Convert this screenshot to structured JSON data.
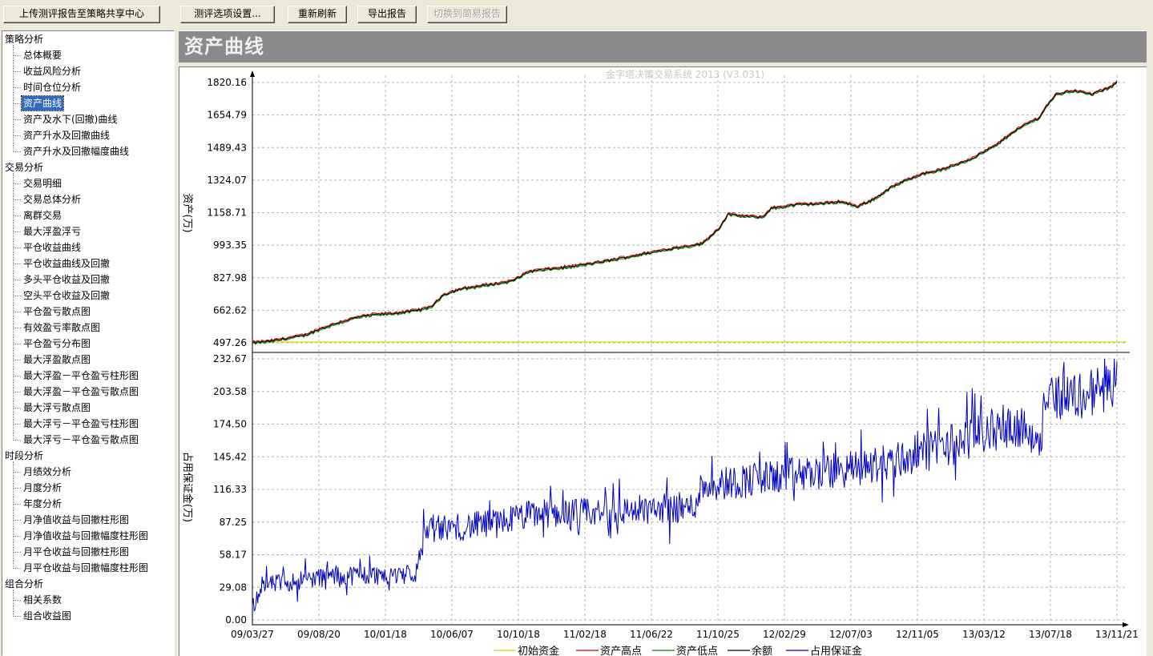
{
  "toolbar": {
    "upload_label": "上传测评报告至策略共享中心",
    "options_label": "测评选项设置...",
    "refresh_label": "重新刷新",
    "export_label": "导出报告",
    "simple_label": "切换到简易报告"
  },
  "tree": {
    "categories": [
      {
        "label": "策略分析",
        "items": [
          "总体概要",
          "收益风险分析",
          "时间仓位分析",
          "资产曲线",
          "资产及水下(回撤)曲线",
          "资产升水及回撤曲线",
          "资产升水及回撤幅度曲线"
        ]
      },
      {
        "label": "交易分析",
        "items": [
          "交易明细",
          "交易总体分析",
          "离群交易",
          "最大浮盈浮亏",
          "平仓收益曲线",
          "平仓收益曲线及回撤",
          "多头平仓收益及回撤",
          "空头平仓收益及回撤",
          "平仓盈亏散点图",
          "有效盈亏率散点图",
          "平仓盈亏分布图",
          "最大浮盈散点图",
          "最大浮盈－平仓盈亏柱形图",
          "最大浮盈－平仓盈亏散点图",
          "最大浮亏散点图",
          "最大浮亏－平仓盈亏柱形图",
          "最大浮亏－平仓盈亏散点图"
        ]
      },
      {
        "label": "时段分析",
        "items": [
          "月绩效分析",
          "月度分析",
          "年度分析",
          "月净值收益与回撤柱形图",
          "月净值收益与回撤幅度柱形图",
          "月平仓收益与回撤柱形图",
          "月平仓收益与回撤幅度柱形图"
        ]
      },
      {
        "label": "组合分析",
        "items": [
          "相关系数",
          "组合收益图"
        ]
      }
    ],
    "selected": "资产曲线"
  },
  "header": {
    "title": "资产曲线"
  },
  "chart_data": {
    "type": "line",
    "title": "金字塔决策交易系统 2013 (V3.031)",
    "x_tick_labels": [
      "09/03/27",
      "09/08/20",
      "10/01/18",
      "10/06/07",
      "10/10/18",
      "11/02/18",
      "11/06/22",
      "11/10/25",
      "12/02/29",
      "12/07/03",
      "12/11/05",
      "13/03/12",
      "13/07/18",
      "13/11/21"
    ],
    "x_range": [
      "09/03/27",
      "13/11/21"
    ],
    "upper_panel": {
      "ylabel": "资产(万)",
      "y_tick_labels": [
        "1820.16",
        "1654.79",
        "1489.43",
        "1324.07",
        "1158.71",
        "993.35",
        "827.98",
        "662.62",
        "497.26"
      ],
      "ylim": [
        497.26,
        1820.16
      ],
      "initial_capital": 497.26,
      "balance_points": [
        {
          "x": 0,
          "y": 497
        },
        {
          "x": 0.02,
          "y": 505
        },
        {
          "x": 0.04,
          "y": 520
        },
        {
          "x": 0.06,
          "y": 535
        },
        {
          "x": 0.08,
          "y": 570
        },
        {
          "x": 0.1,
          "y": 600
        },
        {
          "x": 0.12,
          "y": 625
        },
        {
          "x": 0.14,
          "y": 640
        },
        {
          "x": 0.16,
          "y": 645
        },
        {
          "x": 0.18,
          "y": 655
        },
        {
          "x": 0.2,
          "y": 670
        },
        {
          "x": 0.21,
          "y": 690
        },
        {
          "x": 0.22,
          "y": 740
        },
        {
          "x": 0.24,
          "y": 770
        },
        {
          "x": 0.27,
          "y": 790
        },
        {
          "x": 0.3,
          "y": 810
        },
        {
          "x": 0.32,
          "y": 860
        },
        {
          "x": 0.34,
          "y": 870
        },
        {
          "x": 0.37,
          "y": 885
        },
        {
          "x": 0.4,
          "y": 905
        },
        {
          "x": 0.43,
          "y": 930
        },
        {
          "x": 0.46,
          "y": 955
        },
        {
          "x": 0.49,
          "y": 980
        },
        {
          "x": 0.52,
          "y": 1000
        },
        {
          "x": 0.54,
          "y": 1080
        },
        {
          "x": 0.55,
          "y": 1150
        },
        {
          "x": 0.57,
          "y": 1140
        },
        {
          "x": 0.59,
          "y": 1135
        },
        {
          "x": 0.6,
          "y": 1180
        },
        {
          "x": 0.63,
          "y": 1200
        },
        {
          "x": 0.66,
          "y": 1205
        },
        {
          "x": 0.68,
          "y": 1215
        },
        {
          "x": 0.7,
          "y": 1190
        },
        {
          "x": 0.72,
          "y": 1230
        },
        {
          "x": 0.74,
          "y": 1290
        },
        {
          "x": 0.77,
          "y": 1350
        },
        {
          "x": 0.8,
          "y": 1380
        },
        {
          "x": 0.83,
          "y": 1430
        },
        {
          "x": 0.86,
          "y": 1500
        },
        {
          "x": 0.88,
          "y": 1570
        },
        {
          "x": 0.9,
          "y": 1620
        },
        {
          "x": 0.91,
          "y": 1640
        },
        {
          "x": 0.92,
          "y": 1710
        },
        {
          "x": 0.93,
          "y": 1760
        },
        {
          "x": 0.95,
          "y": 1780
        },
        {
          "x": 0.97,
          "y": 1760
        },
        {
          "x": 0.99,
          "y": 1790
        },
        {
          "x": 1.0,
          "y": 1820
        }
      ]
    },
    "lower_panel": {
      "ylabel": "占用保证金(万)",
      "y_tick_labels": [
        "232.67",
        "203.58",
        "174.50",
        "145.42",
        "116.33",
        "87.25",
        "58.17",
        "29.08",
        "0.00"
      ],
      "ylim": [
        0,
        232.67
      ],
      "margin_trend": [
        {
          "x": 0,
          "y": 10
        },
        {
          "x": 0.01,
          "y": 30
        },
        {
          "x": 0.05,
          "y": 35
        },
        {
          "x": 0.1,
          "y": 40
        },
        {
          "x": 0.15,
          "y": 40
        },
        {
          "x": 0.19,
          "y": 42
        },
        {
          "x": 0.2,
          "y": 80
        },
        {
          "x": 0.27,
          "y": 85
        },
        {
          "x": 0.33,
          "y": 95
        },
        {
          "x": 0.4,
          "y": 95
        },
        {
          "x": 0.47,
          "y": 100
        },
        {
          "x": 0.51,
          "y": 100
        },
        {
          "x": 0.52,
          "y": 120
        },
        {
          "x": 0.58,
          "y": 125
        },
        {
          "x": 0.64,
          "y": 130
        },
        {
          "x": 0.7,
          "y": 135
        },
        {
          "x": 0.76,
          "y": 145
        },
        {
          "x": 0.82,
          "y": 160
        },
        {
          "x": 0.88,
          "y": 175
        },
        {
          "x": 0.91,
          "y": 160
        },
        {
          "x": 0.92,
          "y": 200
        },
        {
          "x": 0.96,
          "y": 200
        },
        {
          "x": 1.0,
          "y": 210
        }
      ]
    },
    "series": [
      {
        "name": "初始资金",
        "color": "#d8d800"
      },
      {
        "name": "资产高点",
        "color": "#d00000"
      },
      {
        "name": "资产低点",
        "color": "#008000"
      },
      {
        "name": "余额",
        "color": "#000000"
      },
      {
        "name": "占用保证金",
        "color": "#0000c0"
      }
    ]
  }
}
